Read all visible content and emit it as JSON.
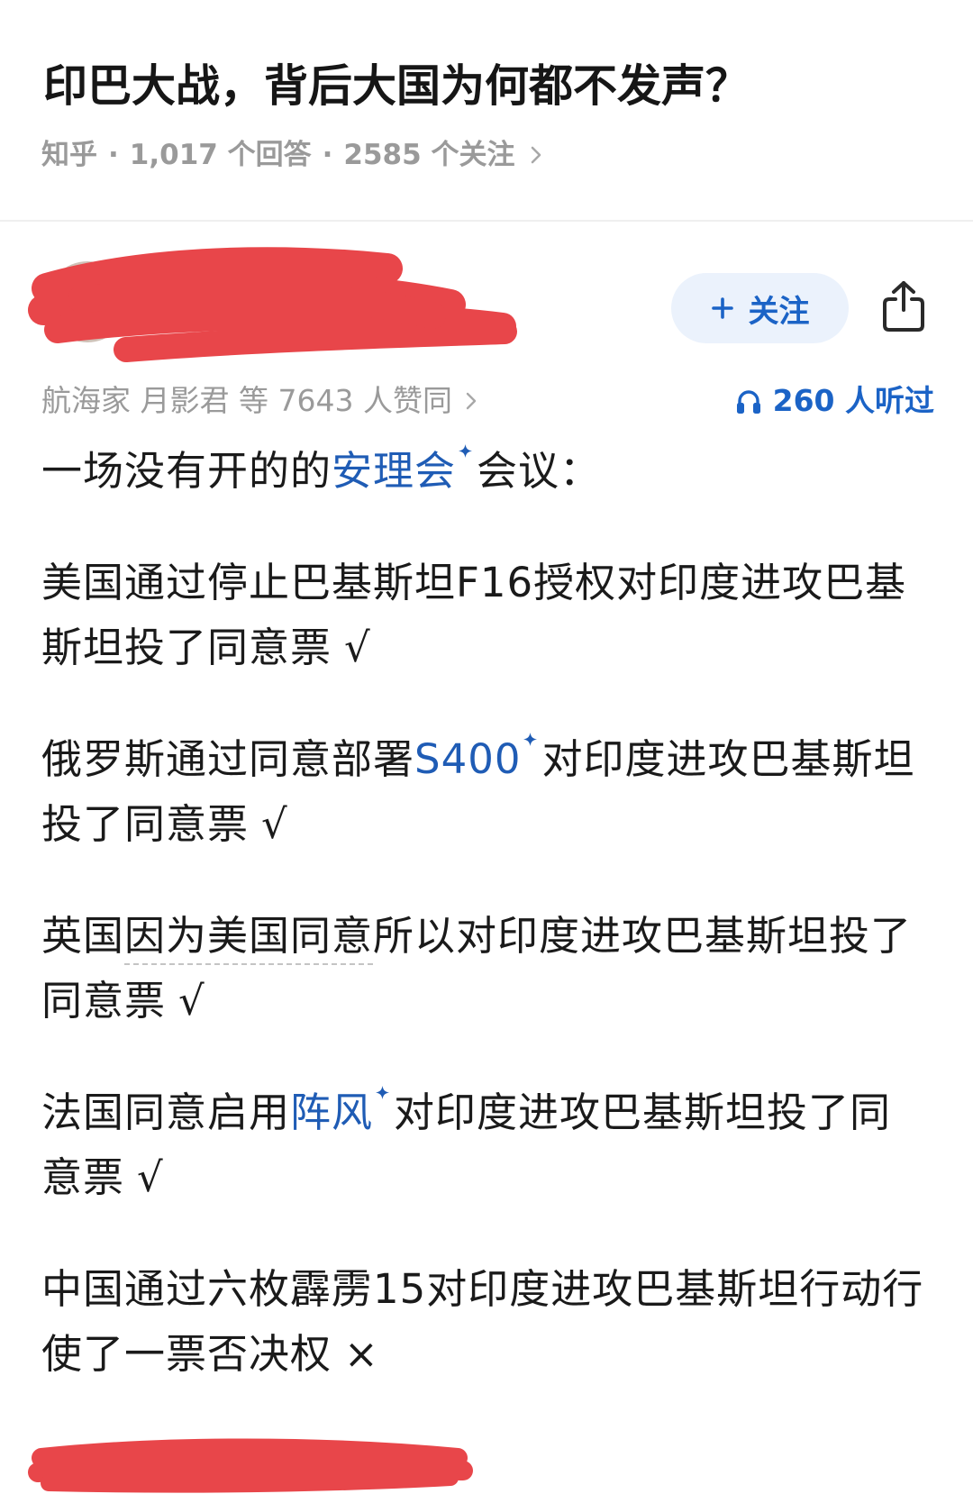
{
  "question": {
    "title": "印巴大战，背后大国为何都不发声？",
    "meta": {
      "source": "知乎",
      "separator": "·",
      "answers": "1,017 个回答",
      "followers": "2585 个关注",
      "chevron_icon": "chevron-right-icon"
    }
  },
  "author": {
    "avatar_icon": "avatar",
    "follow": {
      "icon": "plus-icon",
      "label": "关注"
    },
    "share_icon": "share-icon"
  },
  "stats": {
    "upvotes": "航海家 月影君 等 7643 人赞同",
    "upvotes_chevron_icon": "chevron-right-icon",
    "listen_icon": "headphones-icon",
    "listens": "260 人听过"
  },
  "answer": {
    "intro": {
      "before": "一场没有开的的",
      "link": "安理会",
      "link_icon": "sparkle-icon",
      "after": "会议："
    },
    "items": [
      {
        "line1": "美国通过停止巴基斯坦F16授权对印度进攻巴基",
        "line2": "斯坦投了同意票",
        "mark": "√"
      },
      {
        "line1_before": "俄罗斯通过同意部署",
        "link": "S400",
        "link_icon": "sparkle-icon",
        "line1_after": "对印度进攻巴基斯坦",
        "line2": "投了同意票",
        "mark": "√"
      },
      {
        "line1_before": "英国",
        "underlined": "因为美国同意",
        "line1_after": "所以对印度进攻巴基斯坦投了",
        "line2": "同意票",
        "mark": "√"
      },
      {
        "line1_before": "法国同意启用",
        "link": "阵风",
        "link_icon": "sparkle-icon",
        "line1_after": "对印度进攻巴基斯坦投了同",
        "line2": "意票",
        "mark": "√"
      },
      {
        "line1": "中国通过六枚霹雳15对印度进攻巴基斯坦行动行",
        "line2": "使了一票否决权",
        "mark": "×"
      }
    ]
  },
  "colors": {
    "accent": "#1b63c6",
    "link": "#1f5cb5",
    "text": "#1a1a1a",
    "muted": "#9a9a9a",
    "follow_bg": "#ebf2fc",
    "redaction": "#e8464a"
  }
}
